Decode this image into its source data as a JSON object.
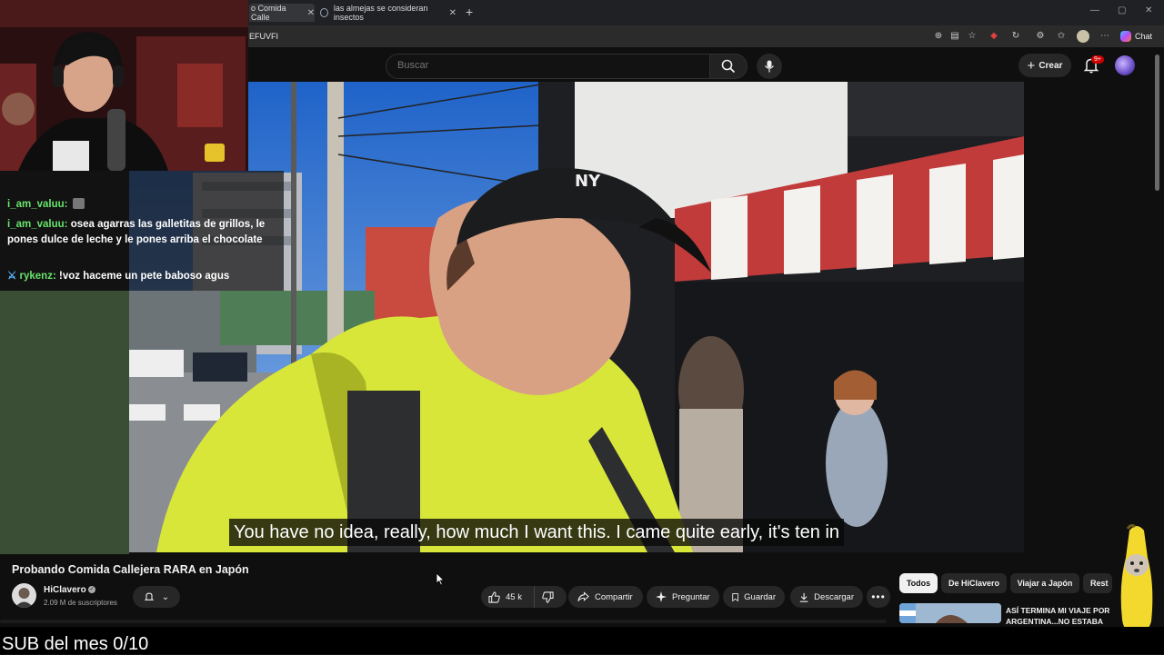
{
  "browser": {
    "tabs": [
      {
        "title": "o Comida Calle",
        "active": true
      },
      {
        "title": "las almejas se consideran insectos",
        "active": false
      }
    ],
    "address_text": "EFUVFI",
    "chat_label": "Chat"
  },
  "header": {
    "search_placeholder": "Buscar",
    "create_label": "Crear",
    "notification_count": "9+"
  },
  "stream_overlay": {
    "chat": [
      {
        "user": "i_am_valuu:",
        "message": ""
      },
      {
        "user": "i_am_valuu:",
        "message": "osea agarras las galletitas de grillos, le pones dulce de leche y le pones arriba el chocolate"
      },
      {
        "user": "rykenz:",
        "message": "!voz haceme un pete baboso agus"
      }
    ],
    "sub_goal": "SUB del mes 0/10"
  },
  "video": {
    "subtitle": "You have no idea, really, how much I want this. I came quite early, it's ten in",
    "title": "Probando Comida Callejera RARA en Japón",
    "channel_name": "HiClavero",
    "subscribers": "2.09 M de suscriptores",
    "like_count": "45 k"
  },
  "actions": {
    "share": "Compartir",
    "ask": "Preguntar",
    "save": "Guardar",
    "download": "Descargar"
  },
  "sidebar": {
    "chips": [
      "Todos",
      "De HiClavero",
      "Viajar a Japón",
      "Rest"
    ],
    "recommendation_title": "ASÍ TERMINA MI VIAJE POR ARGENTINA...NO ESTABA"
  },
  "colors": {
    "background": "#0f0f0f",
    "chat_username": "#68e46d",
    "notification_badge": "#cc0000",
    "jacket": "#d8e63a"
  }
}
